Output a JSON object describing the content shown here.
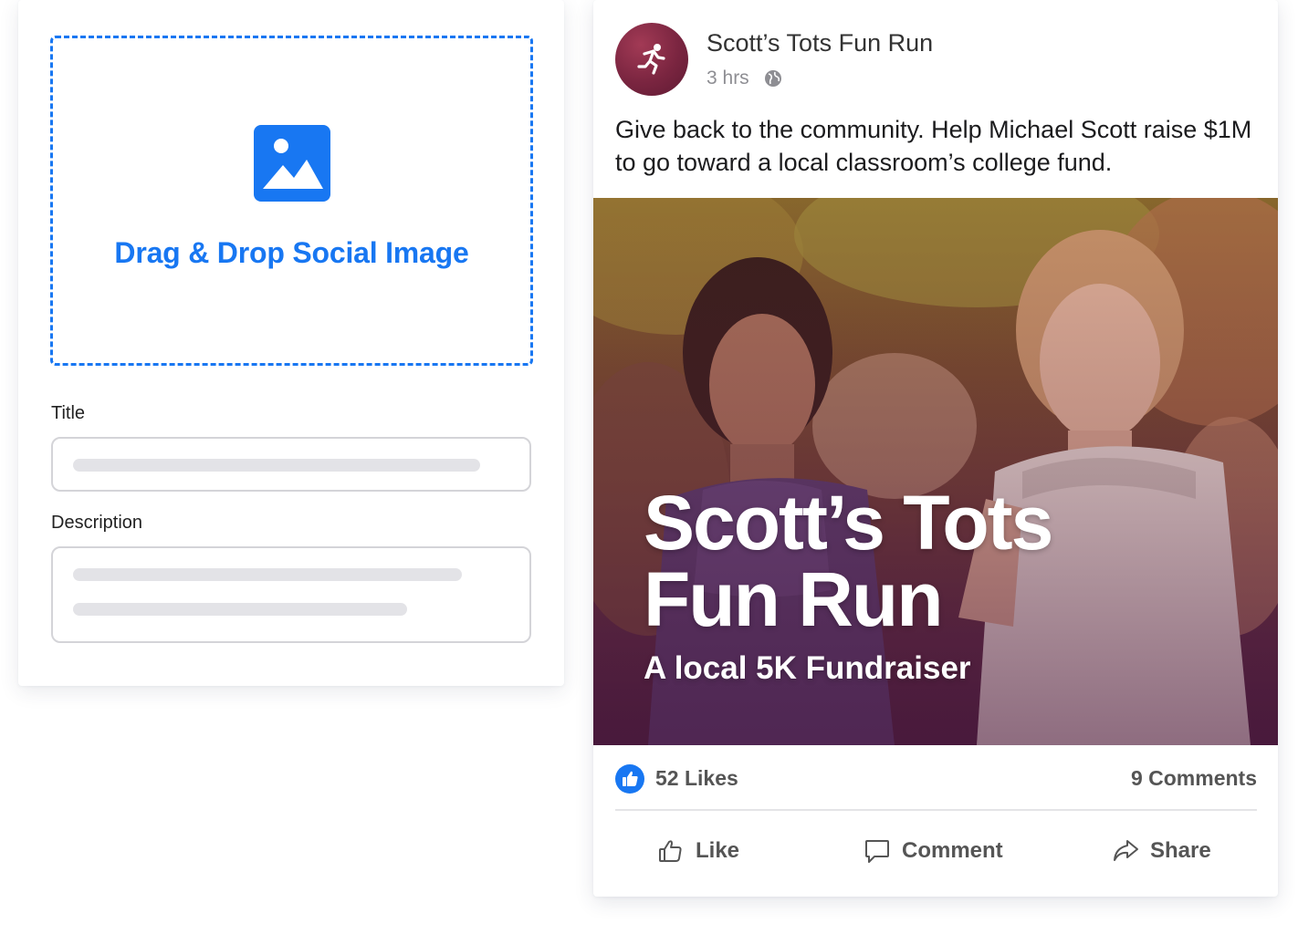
{
  "editor": {
    "dropzone_label": "Drag & Drop Social Image",
    "dropzone_icon": "image-icon",
    "title_label": "Title",
    "description_label": "Description"
  },
  "post": {
    "page_name": "Scott’s Tots Fun Run",
    "time": "3 hrs",
    "privacy_icon": "globe-icon",
    "text": "Give back to the community. Help Michael Scott raise $1M to go toward a local classroom’s college fund.",
    "image": {
      "title_line1": "Scott’s Tots",
      "title_line2": "Fun Run",
      "subtitle": "A local 5K Fundraiser"
    },
    "likes": "52 Likes",
    "comments": "9 Comments",
    "actions": {
      "like": "Like",
      "comment": "Comment",
      "share": "Share"
    }
  },
  "colors": {
    "accent": "#1877f2",
    "avatar": "#7a2540"
  }
}
